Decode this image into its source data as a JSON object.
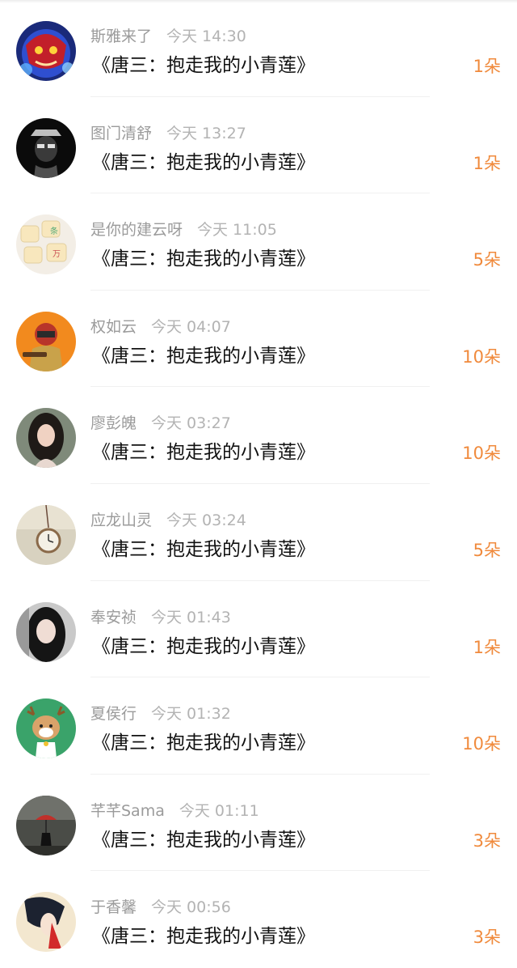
{
  "colors": {
    "accent": "#f08a3c",
    "name": "#9b9b9b",
    "time": "#b3b3b3",
    "title": "#111111"
  },
  "gifts": [
    {
      "user": "斯雅来了",
      "time": "今天 14:30",
      "title": "《唐三：抱走我的小青莲》",
      "count": "1朵",
      "avatar_icon": "warrior-avatar"
    },
    {
      "user": "图门清舒",
      "time": "今天 13:27",
      "title": "《唐三：抱走我的小青莲》",
      "count": "1朵",
      "avatar_icon": "skull-avatar"
    },
    {
      "user": "是你的建云呀",
      "time": "今天 11:05",
      "title": "《唐三：抱走我的小青莲》",
      "count": "5朵",
      "avatar_icon": "mahjong-avatar"
    },
    {
      "user": "权如云",
      "time": "今天 04:07",
      "title": "《唐三：抱走我的小青莲》",
      "count": "10朵",
      "avatar_icon": "soldier-avatar"
    },
    {
      "user": "廖彭魄",
      "time": "今天 03:27",
      "title": "《唐三：抱走我的小青莲》",
      "count": "10朵",
      "avatar_icon": "girl-avatar"
    },
    {
      "user": "应龙山灵",
      "time": "今天 03:24",
      "title": "《唐三：抱走我的小青莲》",
      "count": "5朵",
      "avatar_icon": "pocket-watch-avatar"
    },
    {
      "user": "奉安祯",
      "time": "今天 01:43",
      "title": "《唐三：抱走我的小青莲》",
      "count": "1朵",
      "avatar_icon": "woman-portrait-avatar"
    },
    {
      "user": "夏侯行",
      "time": "今天 01:32",
      "title": "《唐三：抱走我的小青莲》",
      "count": "10朵",
      "avatar_icon": "reindeer-avatar"
    },
    {
      "user": "芊芊Sama",
      "time": "今天 01:11",
      "title": "《唐三：抱走我的小青莲》",
      "count": "3朵",
      "avatar_icon": "umbrella-avatar"
    },
    {
      "user": "于香馨",
      "time": "今天 00:56",
      "title": "《唐三：抱走我的小青莲》",
      "count": "3朵",
      "avatar_icon": "illustration-avatar"
    }
  ]
}
